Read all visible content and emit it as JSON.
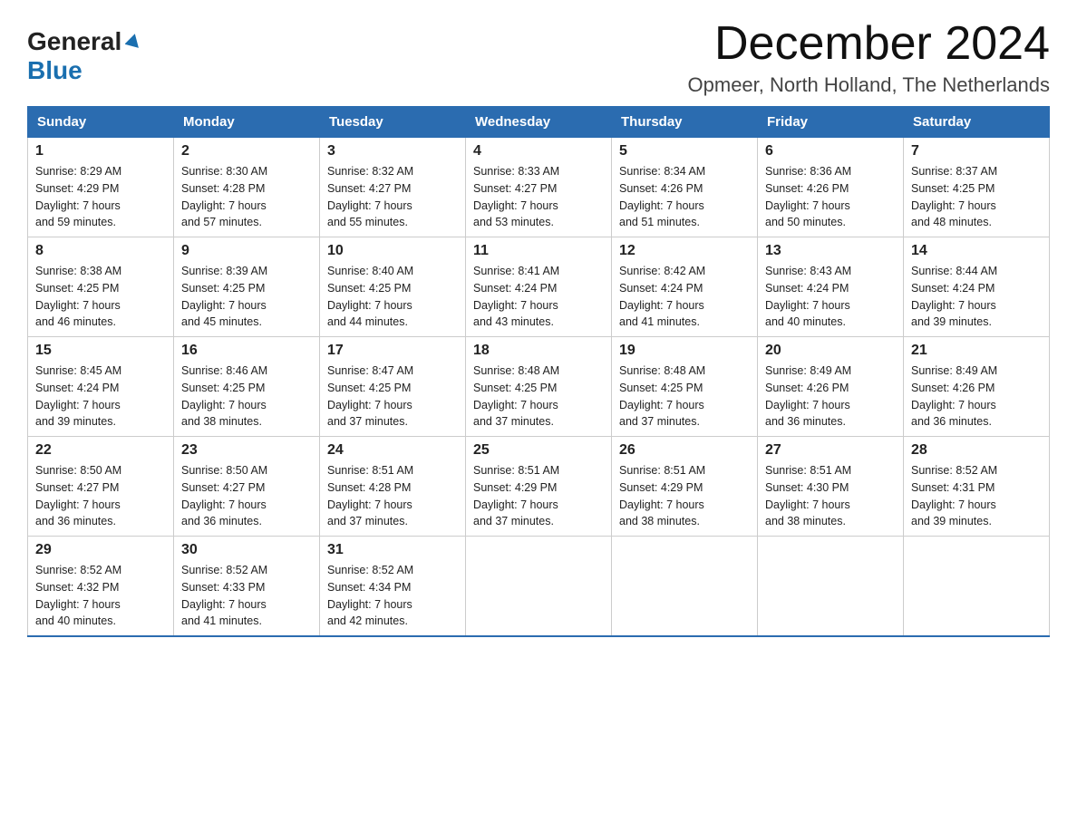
{
  "logo": {
    "general": "General",
    "blue": "Blue"
  },
  "header": {
    "month_year": "December 2024",
    "location": "Opmeer, North Holland, The Netherlands"
  },
  "days_of_week": [
    "Sunday",
    "Monday",
    "Tuesday",
    "Wednesday",
    "Thursday",
    "Friday",
    "Saturday"
  ],
  "weeks": [
    [
      {
        "day": "1",
        "sunrise": "8:29 AM",
        "sunset": "4:29 PM",
        "daylight": "7 hours and 59 minutes."
      },
      {
        "day": "2",
        "sunrise": "8:30 AM",
        "sunset": "4:28 PM",
        "daylight": "7 hours and 57 minutes."
      },
      {
        "day": "3",
        "sunrise": "8:32 AM",
        "sunset": "4:27 PM",
        "daylight": "7 hours and 55 minutes."
      },
      {
        "day": "4",
        "sunrise": "8:33 AM",
        "sunset": "4:27 PM",
        "daylight": "7 hours and 53 minutes."
      },
      {
        "day": "5",
        "sunrise": "8:34 AM",
        "sunset": "4:26 PM",
        "daylight": "7 hours and 51 minutes."
      },
      {
        "day": "6",
        "sunrise": "8:36 AM",
        "sunset": "4:26 PM",
        "daylight": "7 hours and 50 minutes."
      },
      {
        "day": "7",
        "sunrise": "8:37 AM",
        "sunset": "4:25 PM",
        "daylight": "7 hours and 48 minutes."
      }
    ],
    [
      {
        "day": "8",
        "sunrise": "8:38 AM",
        "sunset": "4:25 PM",
        "daylight": "7 hours and 46 minutes."
      },
      {
        "day": "9",
        "sunrise": "8:39 AM",
        "sunset": "4:25 PM",
        "daylight": "7 hours and 45 minutes."
      },
      {
        "day": "10",
        "sunrise": "8:40 AM",
        "sunset": "4:25 PM",
        "daylight": "7 hours and 44 minutes."
      },
      {
        "day": "11",
        "sunrise": "8:41 AM",
        "sunset": "4:24 PM",
        "daylight": "7 hours and 43 minutes."
      },
      {
        "day": "12",
        "sunrise": "8:42 AM",
        "sunset": "4:24 PM",
        "daylight": "7 hours and 41 minutes."
      },
      {
        "day": "13",
        "sunrise": "8:43 AM",
        "sunset": "4:24 PM",
        "daylight": "7 hours and 40 minutes."
      },
      {
        "day": "14",
        "sunrise": "8:44 AM",
        "sunset": "4:24 PM",
        "daylight": "7 hours and 39 minutes."
      }
    ],
    [
      {
        "day": "15",
        "sunrise": "8:45 AM",
        "sunset": "4:24 PM",
        "daylight": "7 hours and 39 minutes."
      },
      {
        "day": "16",
        "sunrise": "8:46 AM",
        "sunset": "4:25 PM",
        "daylight": "7 hours and 38 minutes."
      },
      {
        "day": "17",
        "sunrise": "8:47 AM",
        "sunset": "4:25 PM",
        "daylight": "7 hours and 37 minutes."
      },
      {
        "day": "18",
        "sunrise": "8:48 AM",
        "sunset": "4:25 PM",
        "daylight": "7 hours and 37 minutes."
      },
      {
        "day": "19",
        "sunrise": "8:48 AM",
        "sunset": "4:25 PM",
        "daylight": "7 hours and 37 minutes."
      },
      {
        "day": "20",
        "sunrise": "8:49 AM",
        "sunset": "4:26 PM",
        "daylight": "7 hours and 36 minutes."
      },
      {
        "day": "21",
        "sunrise": "8:49 AM",
        "sunset": "4:26 PM",
        "daylight": "7 hours and 36 minutes."
      }
    ],
    [
      {
        "day": "22",
        "sunrise": "8:50 AM",
        "sunset": "4:27 PM",
        "daylight": "7 hours and 36 minutes."
      },
      {
        "day": "23",
        "sunrise": "8:50 AM",
        "sunset": "4:27 PM",
        "daylight": "7 hours and 36 minutes."
      },
      {
        "day": "24",
        "sunrise": "8:51 AM",
        "sunset": "4:28 PM",
        "daylight": "7 hours and 37 minutes."
      },
      {
        "day": "25",
        "sunrise": "8:51 AM",
        "sunset": "4:29 PM",
        "daylight": "7 hours and 37 minutes."
      },
      {
        "day": "26",
        "sunrise": "8:51 AM",
        "sunset": "4:29 PM",
        "daylight": "7 hours and 38 minutes."
      },
      {
        "day": "27",
        "sunrise": "8:51 AM",
        "sunset": "4:30 PM",
        "daylight": "7 hours and 38 minutes."
      },
      {
        "day": "28",
        "sunrise": "8:52 AM",
        "sunset": "4:31 PM",
        "daylight": "7 hours and 39 minutes."
      }
    ],
    [
      {
        "day": "29",
        "sunrise": "8:52 AM",
        "sunset": "4:32 PM",
        "daylight": "7 hours and 40 minutes."
      },
      {
        "day": "30",
        "sunrise": "8:52 AM",
        "sunset": "4:33 PM",
        "daylight": "7 hours and 41 minutes."
      },
      {
        "day": "31",
        "sunrise": "8:52 AM",
        "sunset": "4:34 PM",
        "daylight": "7 hours and 42 minutes."
      },
      null,
      null,
      null,
      null
    ]
  ],
  "labels": {
    "sunrise": "Sunrise:",
    "sunset": "Sunset:",
    "daylight": "Daylight:"
  }
}
